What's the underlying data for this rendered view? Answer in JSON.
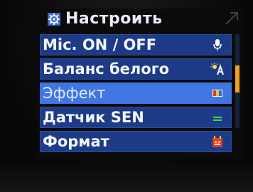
{
  "window": {
    "title": "Настроить"
  },
  "menu": {
    "items": [
      {
        "label": "Mic. ON / OFF",
        "icon": "microphone-icon",
        "selected": false
      },
      {
        "label": "Баланс белого",
        "icon": "white-balance-icon",
        "selected": false
      },
      {
        "label": "Эффект",
        "icon": "effect-icon",
        "selected": true
      },
      {
        "label": "Датчик SEN",
        "icon": "sensor-icon",
        "selected": false
      },
      {
        "label": "Формат",
        "icon": "format-icon",
        "selected": false
      }
    ]
  },
  "colors": {
    "item_bg": "#1d3b86",
    "item_selected_bg": "#3f76e3",
    "scroll_thumb": "#f0a21c"
  }
}
